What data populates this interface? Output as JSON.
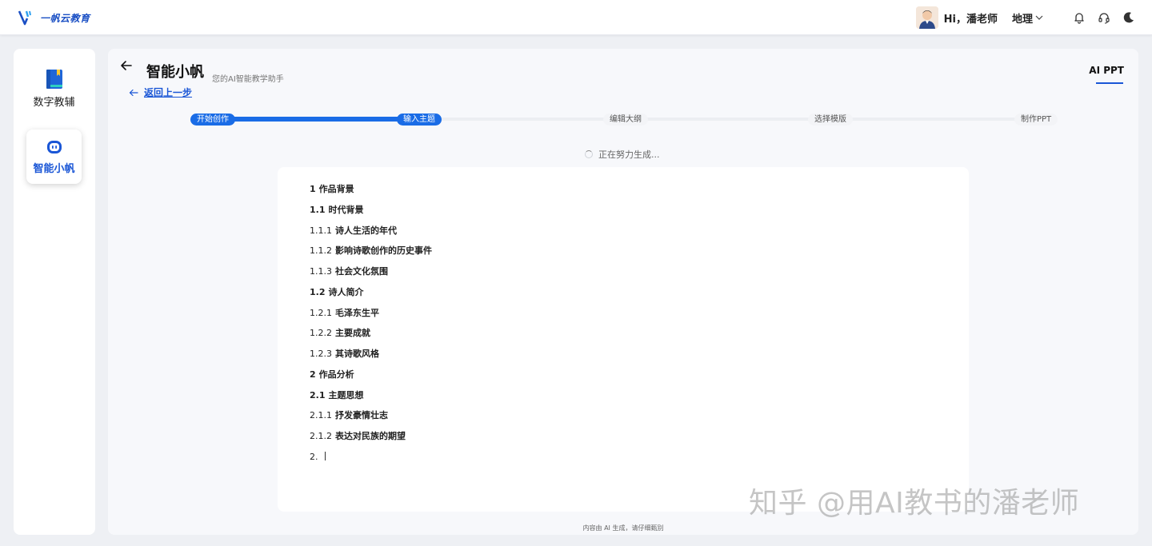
{
  "app": {
    "logo_text": "一帆云教育",
    "greeting": "Hi，潘老师",
    "subject": "地理",
    "icons": [
      "logo-icon",
      "chevron-down-icon",
      "bell-icon",
      "headset-icon",
      "moon-icon"
    ]
  },
  "sidebar": {
    "items": [
      {
        "label": "数字教辅",
        "icon": "book-icon",
        "active": false
      },
      {
        "label": "智能小帆",
        "icon": "robot-icon",
        "active": true
      }
    ]
  },
  "header": {
    "title": "智能小帆",
    "subtitle": "您的AI智能教学助手",
    "back_link": "返回上一步",
    "tab": "AI PPT"
  },
  "steps": [
    {
      "label": "开始创作",
      "done": true
    },
    {
      "label": "输入主题",
      "done": true
    },
    {
      "label": "编辑大纲",
      "done": false
    },
    {
      "label": "选择模版",
      "done": false
    },
    {
      "label": "制作PPT",
      "done": false
    }
  ],
  "status": "正在努力生成...",
  "outline": [
    {
      "num": "1",
      "title": "作品背景",
      "level": 1
    },
    {
      "num": "1.1",
      "title": "时代背景",
      "level": 2
    },
    {
      "num": "1.1.1",
      "title": "诗人生活的年代",
      "level": 3
    },
    {
      "num": "1.1.2",
      "title": "影响诗歌创作的历史事件",
      "level": 3
    },
    {
      "num": "1.1.3",
      "title": "社会文化氛围",
      "level": 3
    },
    {
      "num": "1.2",
      "title": "诗人简介",
      "level": 2
    },
    {
      "num": "1.2.1",
      "title": "毛泽东生平",
      "level": 3
    },
    {
      "num": "1.2.2",
      "title": "主要成就",
      "level": 3
    },
    {
      "num": "1.2.3",
      "title": "其诗歌风格",
      "level": 3
    },
    {
      "num": "2",
      "title": "作品分析",
      "level": 1
    },
    {
      "num": "2.1",
      "title": "主题思想",
      "level": 2
    },
    {
      "num": "2.1.1",
      "title": "抒发豪情壮志",
      "level": 3
    },
    {
      "num": "2.1.2",
      "title": "表达对民族的期望",
      "level": 3
    },
    {
      "num": "2.",
      "title": "",
      "level": 3
    }
  ],
  "footer_note": "内容由 AI 生成，请仔细甄别",
  "watermark": "知乎 @用AI教书的潘老师",
  "colors": {
    "accent": "#1a6ce6",
    "link": "#1a56d6",
    "background": "#eef0f4"
  }
}
